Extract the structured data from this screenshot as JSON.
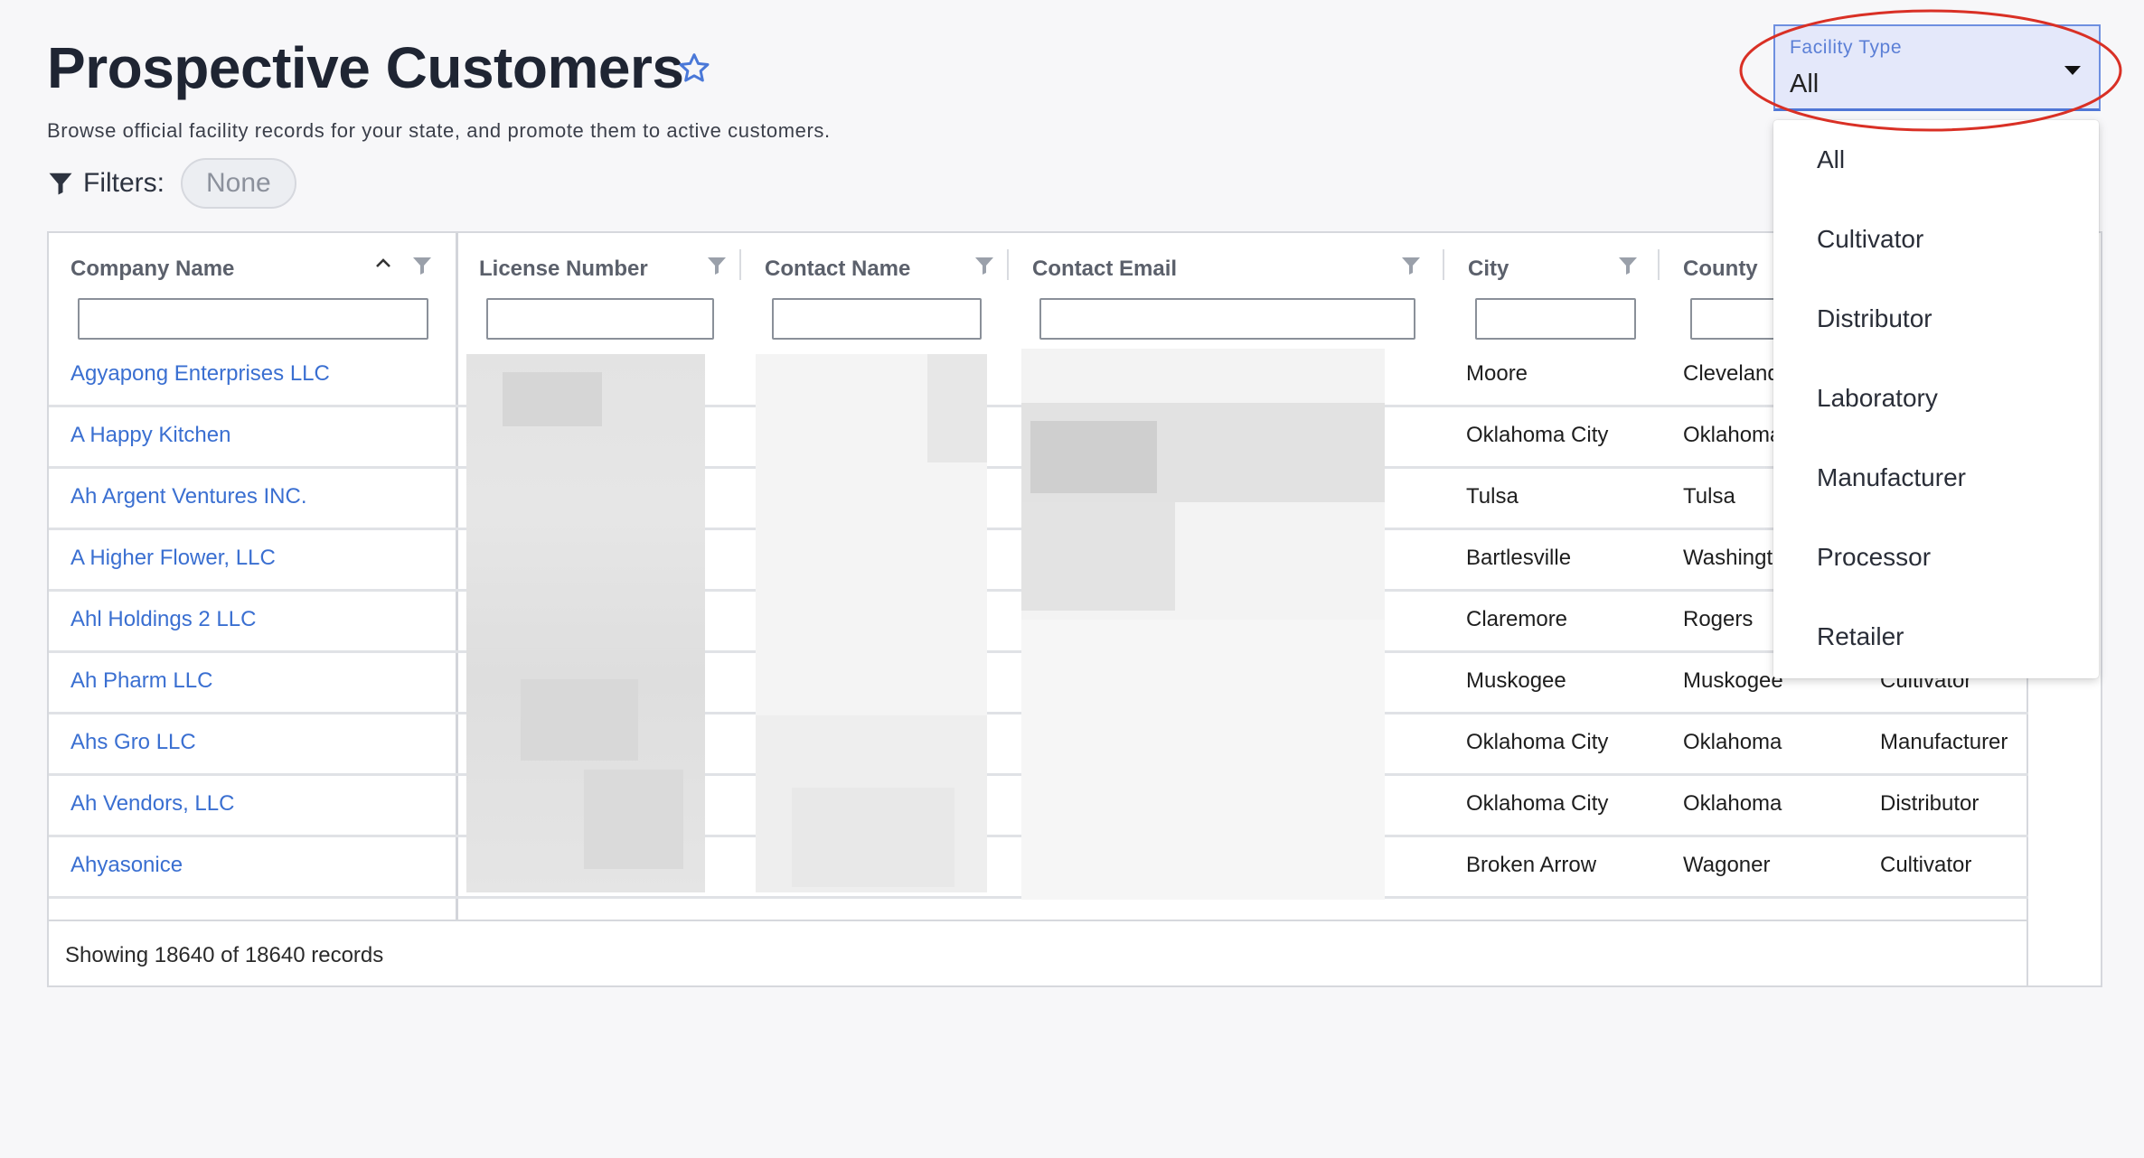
{
  "page": {
    "title": "Prospective Customers",
    "subtitle": "Browse official facility records for your state, and promote them to active customers.",
    "filters_label": "Filters:",
    "filters_value": "None"
  },
  "facility_type": {
    "label": "Facility Type",
    "value": "All",
    "options": [
      "All",
      "Cultivator",
      "Distributor",
      "Laboratory",
      "Manufacturer",
      "Processor",
      "Retailer"
    ]
  },
  "table": {
    "columns": [
      "Company Name",
      "License Number",
      "Contact Name",
      "Contact Email",
      "City",
      "County"
    ],
    "rows": [
      {
        "company": "Agyapong Enterprises LLC",
        "city": "Moore",
        "county": "Cleveland",
        "type": ""
      },
      {
        "company": "A Happy Kitchen",
        "city": "Oklahoma City",
        "county": "Oklahoma",
        "type": ""
      },
      {
        "company": "Ah Argent Ventures INC.",
        "city": "Tulsa",
        "county": "Tulsa",
        "type": ""
      },
      {
        "company": "A Higher Flower, LLC",
        "city": "Bartlesville",
        "county": "Washington",
        "type": ""
      },
      {
        "company": "Ahl Holdings 2 LLC",
        "city": "Claremore",
        "county": "Rogers",
        "type": ""
      },
      {
        "company": "Ah Pharm LLC",
        "city": "Muskogee",
        "county": "Muskogee",
        "type": "Cultivator"
      },
      {
        "company": "Ahs Gro LLC",
        "city": "Oklahoma City",
        "county": "Oklahoma",
        "type": "Manufacturer"
      },
      {
        "company": "Ah Vendors, LLC",
        "city": "Oklahoma City",
        "county": "Oklahoma",
        "type": "Distributor"
      },
      {
        "company": "Ahyasonice",
        "city": "Broken Arrow",
        "county": "Wagoner",
        "type": "Cultivator"
      }
    ],
    "footer": "Showing 18640 of 18640 records"
  },
  "colors": {
    "link": "#3a6fd1",
    "select_bg": "#e4e8fa",
    "select_border": "#4f76d6",
    "highlight": "#d93025"
  },
  "icons": [
    "star-icon",
    "filter-icon",
    "caret-down-icon",
    "sort-ascending-icon",
    "column-filter-icon"
  ]
}
